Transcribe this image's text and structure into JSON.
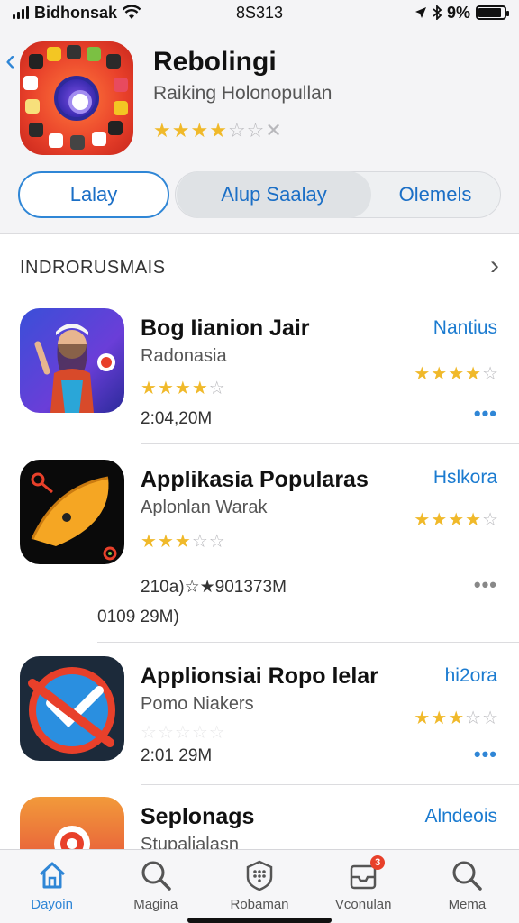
{
  "status_bar": {
    "carrier": "Bidhonsak",
    "time": "8S313",
    "battery_text": "9%",
    "battery_level": 0.9
  },
  "app": {
    "title": "Rebolingi",
    "subtitle": "Raiking Holonopullan",
    "rating_stars": 4,
    "rating_total": 6,
    "rating_suffix": "✕"
  },
  "segments": [
    "Lalay",
    "Alup Saalay",
    "Olemels"
  ],
  "section": {
    "title": "INDRORUSMAIS"
  },
  "items": [
    {
      "title": "Bog Iianion Jair",
      "subtitle": "Radonasia",
      "size": "2:04,20M",
      "category": "Nantius",
      "left_rating": 4,
      "right_rating": 4,
      "more": "•••"
    },
    {
      "title": "Applikasia Popularas",
      "subtitle": "Aplonlan Warak",
      "size": "210a)☆★901373M",
      "size_extra": "0109 29M)",
      "category": "Hslkora",
      "left_rating": 3,
      "right_rating": 4,
      "more": "•••"
    },
    {
      "title": "Applionsiai Ropo lelar",
      "subtitle": "Pomo Niakers",
      "size": "2:01 29M",
      "category": "hi2ora",
      "left_rating": 0,
      "right_rating": 3,
      "more": "•••"
    },
    {
      "title": "Seplonags",
      "subtitle": "Stupalialasn",
      "category": "Alndeois"
    }
  ],
  "tabs": [
    {
      "label": "Dayoin",
      "icon": "home-icon",
      "active": true
    },
    {
      "label": "Magina",
      "icon": "search-icon",
      "active": false
    },
    {
      "label": "Robaman",
      "icon": "grid-shield-icon",
      "active": false
    },
    {
      "label": "Vconulan",
      "icon": "inbox-icon",
      "active": false,
      "badge": "3"
    },
    {
      "label": "Mema",
      "icon": "search-icon",
      "active": false
    }
  ],
  "colors": {
    "accent": "#2f86d6",
    "star": "#f0b92a",
    "badge": "#e8402a"
  }
}
